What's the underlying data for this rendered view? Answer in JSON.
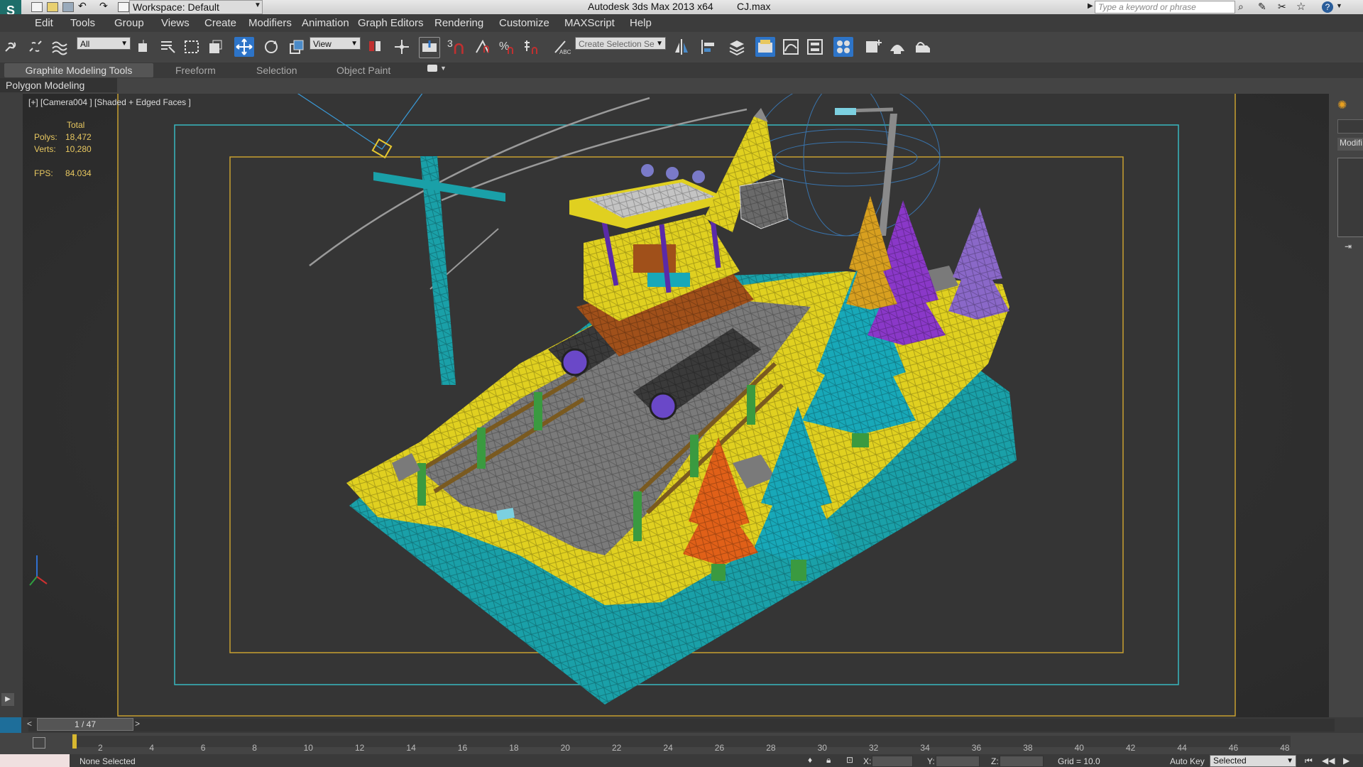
{
  "title_bar": {
    "workspace": "Workspace: Default",
    "app_title": "Autodesk 3ds Max  2013 x64",
    "file_name": "CJ.max",
    "search_placeholder": "Type a keyword or phrase"
  },
  "menu": [
    "Edit",
    "Tools",
    "Group",
    "Views",
    "Create",
    "Modifiers",
    "Animation",
    "Graph Editors",
    "Rendering",
    "Customize",
    "MAXScript",
    "Help"
  ],
  "toolbar": {
    "selection_filter": "All",
    "reference_coord": "View",
    "named_selection": "Create Selection Se",
    "snap_label": "3"
  },
  "ribbon": {
    "tabs": [
      "Graphite Modeling Tools",
      "Freeform",
      "Selection",
      "Object Paint"
    ],
    "panel": "Polygon Modeling"
  },
  "viewport": {
    "label": "[+] [Camera004 ] [Shaded + Edged Faces ]",
    "stats": {
      "header": "Total",
      "polys_label": "Polys:",
      "polys": "18,472",
      "verts_label": "Verts:",
      "verts": "10,280",
      "fps_label": "FPS:",
      "fps": "84.034"
    }
  },
  "right_panel": {
    "tab": "Modifi"
  },
  "timeline": {
    "frame": "1 / 47",
    "prev": "<",
    "next": ">",
    "ticks": [
      "2",
      "4",
      "6",
      "8",
      "10",
      "12",
      "14",
      "16",
      "18",
      "20",
      "22",
      "24",
      "26",
      "28",
      "30",
      "32",
      "34",
      "36",
      "38",
      "40",
      "42",
      "44",
      "46",
      "48"
    ]
  },
  "status": {
    "selection": "None Selected",
    "x_label": "X:",
    "y_label": "Y:",
    "z_label": "Z:",
    "grid": "Grid = 10.0",
    "auto_key": "Auto Key",
    "key_filter": "Selected"
  },
  "colors": {
    "ground_yellow": "#e0d020",
    "base_teal": "#1aa0a8",
    "road_gray": "#7a7a7a",
    "tree_teal": "#18a8b8",
    "tree_purple": "#8a38c8",
    "tree_orange": "#e06018",
    "safe_frame_teal": "#38b8c0",
    "safe_frame_yellow": "#c8a030"
  }
}
